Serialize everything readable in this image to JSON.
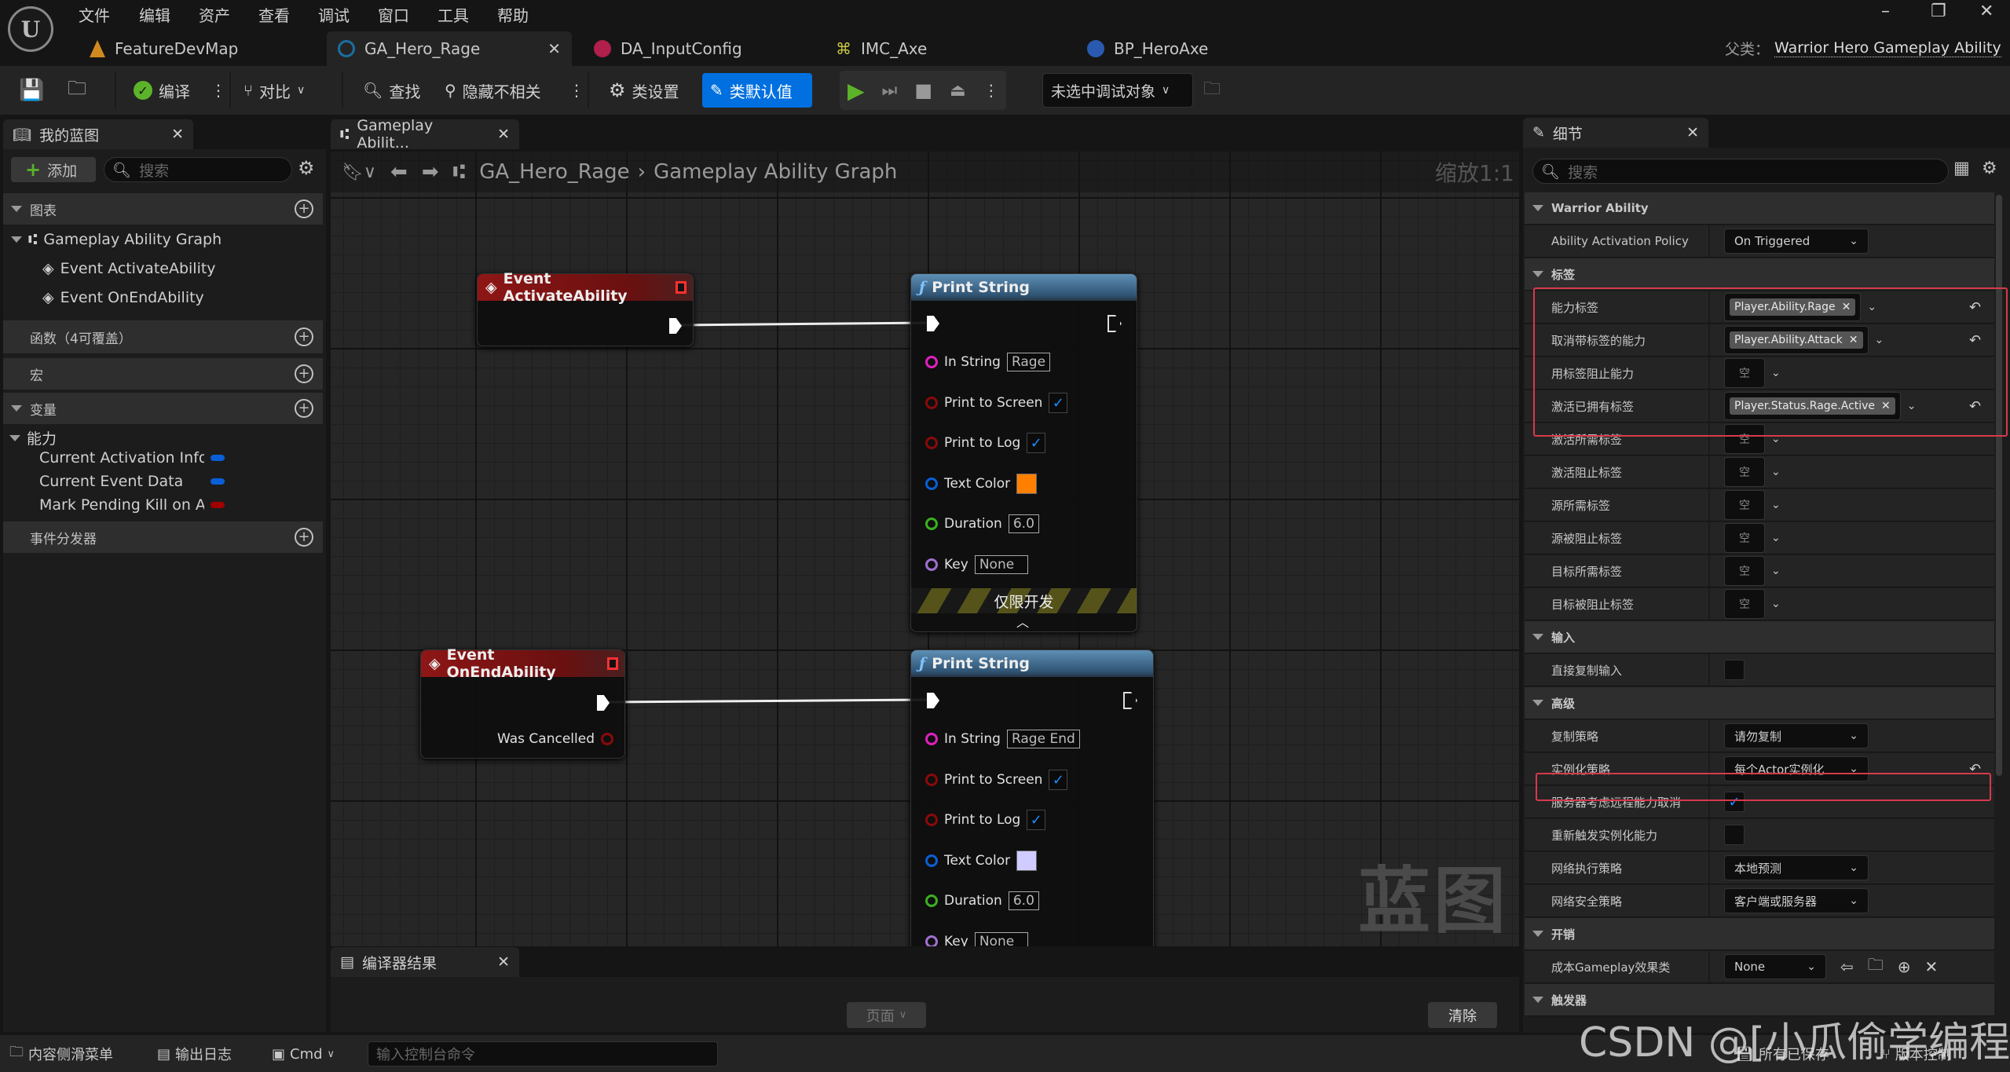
{
  "menu": [
    "文件",
    "编辑",
    "资产",
    "查看",
    "调试",
    "窗口",
    "工具",
    "帮助"
  ],
  "doc_tabs": [
    {
      "label": "FeatureDevMap",
      "icon": "level-icon",
      "color": "#d08a20"
    },
    {
      "label": "GA_Hero_Rage",
      "icon": "blueprint-icon",
      "color": "#1a6fa0",
      "active": true
    },
    {
      "label": "DA_InputConfig",
      "icon": "data-asset-icon",
      "color": "#b0204a"
    },
    {
      "label": "IMC_Axe",
      "icon": "input-mapping-icon",
      "color": "#c8c840"
    },
    {
      "label": "BP_HeroAxe",
      "icon": "actor-blueprint-icon",
      "color": "#2a5ab0"
    }
  ],
  "parent_class": {
    "label": "父类：",
    "value": "Warrior Hero Gameplay Ability"
  },
  "toolbar": {
    "compile": "编译",
    "diff": "对比",
    "find": "查找",
    "hide_unrelated": "隐藏不相关",
    "class_settings": "类设置",
    "class_defaults": "类默认值",
    "debug_target": "未选中调试对象",
    "accent": "#0070e0"
  },
  "my_blueprint": {
    "tab": "我的蓝图",
    "add": "添加",
    "search_placeholder": "搜索",
    "sections": {
      "graphs": "图表",
      "functions": "函数（4可覆盖）",
      "macros": "宏",
      "variables": "变量",
      "dispatchers": "事件分发器"
    },
    "graph_name": "Gameplay Ability Graph",
    "events": [
      "Event ActivateAbility",
      "Event OnEndAbility"
    ],
    "var_category": "能力",
    "variables": [
      {
        "name": "Current Activation Info",
        "color": "#0a5fd6"
      },
      {
        "name": "Current Event Data",
        "color": "#0a5fd6"
      },
      {
        "name": "Mark Pending Kill on Ab",
        "color": "#a00000"
      }
    ]
  },
  "graph": {
    "tab": "Gameplay Abilit...",
    "breadcrumb": [
      "GA_Hero_Rage",
      "Gameplay Ability Graph"
    ],
    "zoom": "缩放1:1",
    "watermark": "蓝图",
    "nodes": {
      "activate": {
        "title": "Event ActivateAbility"
      },
      "end": {
        "title": "Event OnEndAbility",
        "was_cancelled": "Was Cancelled"
      },
      "print1": {
        "title": "Print String",
        "in_string": "In String",
        "in_string_value": "Rage",
        "print_to_screen": "Print to Screen",
        "print_to_log": "Print to Log",
        "text_color": "Text Color",
        "text_color_value": "#ff8000",
        "duration": "Duration",
        "duration_value": "6.0",
        "key": "Key",
        "key_value": "None",
        "dev_only": "仅限开发"
      },
      "print2": {
        "title": "Print String",
        "in_string": "In String",
        "in_string_value": "Rage End",
        "print_to_screen": "Print to Screen",
        "print_to_log": "Print to Log",
        "text_color": "Text Color",
        "text_color_value": "#d0ccff",
        "duration": "Duration",
        "duration_value": "6.0",
        "key": "Key",
        "key_value": "None"
      }
    }
  },
  "details": {
    "tab": "细节",
    "search_placeholder": "搜索",
    "rows": [
      {
        "type": "cat",
        "label": "Warrior Ability"
      },
      {
        "type": "dd",
        "label": "Ability Activation Policy",
        "value": "On Triggered"
      },
      {
        "type": "cat",
        "label": "标签"
      },
      {
        "type": "tag",
        "label": "能力标签",
        "value": "Player.Ability.Rage",
        "reset": true
      },
      {
        "type": "tag",
        "label": "取消带标签的能力",
        "value": "Player.Ability.Attack",
        "reset": true
      },
      {
        "type": "empty",
        "label": "用标签阻止能力",
        "value": "空"
      },
      {
        "type": "tag",
        "label": "激活已拥有标签",
        "value": "Player.Status.Rage.Active",
        "reset": true
      },
      {
        "type": "empty",
        "label": "激活所需标签",
        "value": "空"
      },
      {
        "type": "empty",
        "label": "激活阻止标签",
        "value": "空"
      },
      {
        "type": "empty",
        "label": "源所需标签",
        "value": "空"
      },
      {
        "type": "empty",
        "label": "源被阻止标签",
        "value": "空"
      },
      {
        "type": "empty",
        "label": "目标所需标签",
        "value": "空"
      },
      {
        "type": "empty",
        "label": "目标被阻止标签",
        "value": "空"
      },
      {
        "type": "cat",
        "label": "输入"
      },
      {
        "type": "cb",
        "label": "直接复制输入",
        "checked": false
      },
      {
        "type": "cat",
        "label": "高级"
      },
      {
        "type": "dd",
        "label": "复制策略",
        "value": "请勿复制"
      },
      {
        "type": "dd",
        "label": "实例化策略",
        "value": "每个Actor实例化",
        "reset": true
      },
      {
        "type": "cb",
        "label": "服务器考虑远程能力取消",
        "checked": true
      },
      {
        "type": "cb",
        "label": "重新触发实例化能力",
        "checked": false
      },
      {
        "type": "dd",
        "label": "网络执行策略",
        "value": "本地预测"
      },
      {
        "type": "dd",
        "label": "网络安全策略",
        "value": "客户端或服务器"
      },
      {
        "type": "cat",
        "label": "开销"
      },
      {
        "type": "cls",
        "label": "成本Gameplay效果类",
        "value": "None"
      },
      {
        "type": "cat",
        "label": "触发器"
      }
    ]
  },
  "compiler": {
    "tab": "编译器结果",
    "page": "页面",
    "clear": "清除"
  },
  "status_bar": {
    "content_drawer": "内容侧滑菜单",
    "output_log": "输出日志",
    "cmd": "Cmd",
    "console_placeholder": "输入控制台命令",
    "all_saved": "所有已保存",
    "source_control": "版本控制"
  },
  "watermark": "CSDN @[小瓜偷学编程]"
}
